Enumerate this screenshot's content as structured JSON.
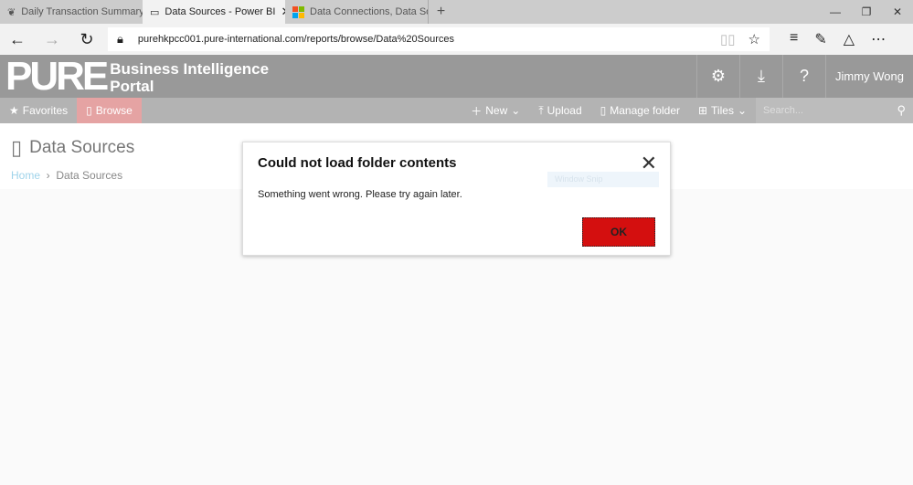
{
  "browser": {
    "tabs": [
      {
        "label": "Daily Transaction Summary",
        "icon": "app-icon"
      },
      {
        "label": "Data Sources - Power BI",
        "icon": "page-icon",
        "close": "✕"
      },
      {
        "label": "Data Connections, Data Sou",
        "icon": "microsoft-icon"
      }
    ],
    "new_tab": "+",
    "url": "purehkpcc001.pure-international.com/reports/browse/Data%20Sources"
  },
  "portal": {
    "logo": "PURE",
    "title_line1": "Business Intelligence",
    "title_line2": "Portal",
    "user": "Jimmy Wong",
    "toolbar": {
      "favorites": "Favorites",
      "browse": "Browse",
      "new": "New",
      "upload": "Upload",
      "manage": "Manage folder",
      "tiles": "Tiles",
      "search_placeholder": "Search..."
    }
  },
  "page": {
    "title": "Data Sources",
    "breadcrumb": [
      "Home",
      "Data Sources"
    ]
  },
  "dialog": {
    "title": "Could not load folder contents",
    "message": "Something went wrong. Please try again later.",
    "ok": "OK",
    "overlay": "Window Snip"
  },
  "colors": {
    "ok_button": "#d40f0f",
    "header": "#999999",
    "browse_active": "#e5a3a3"
  }
}
